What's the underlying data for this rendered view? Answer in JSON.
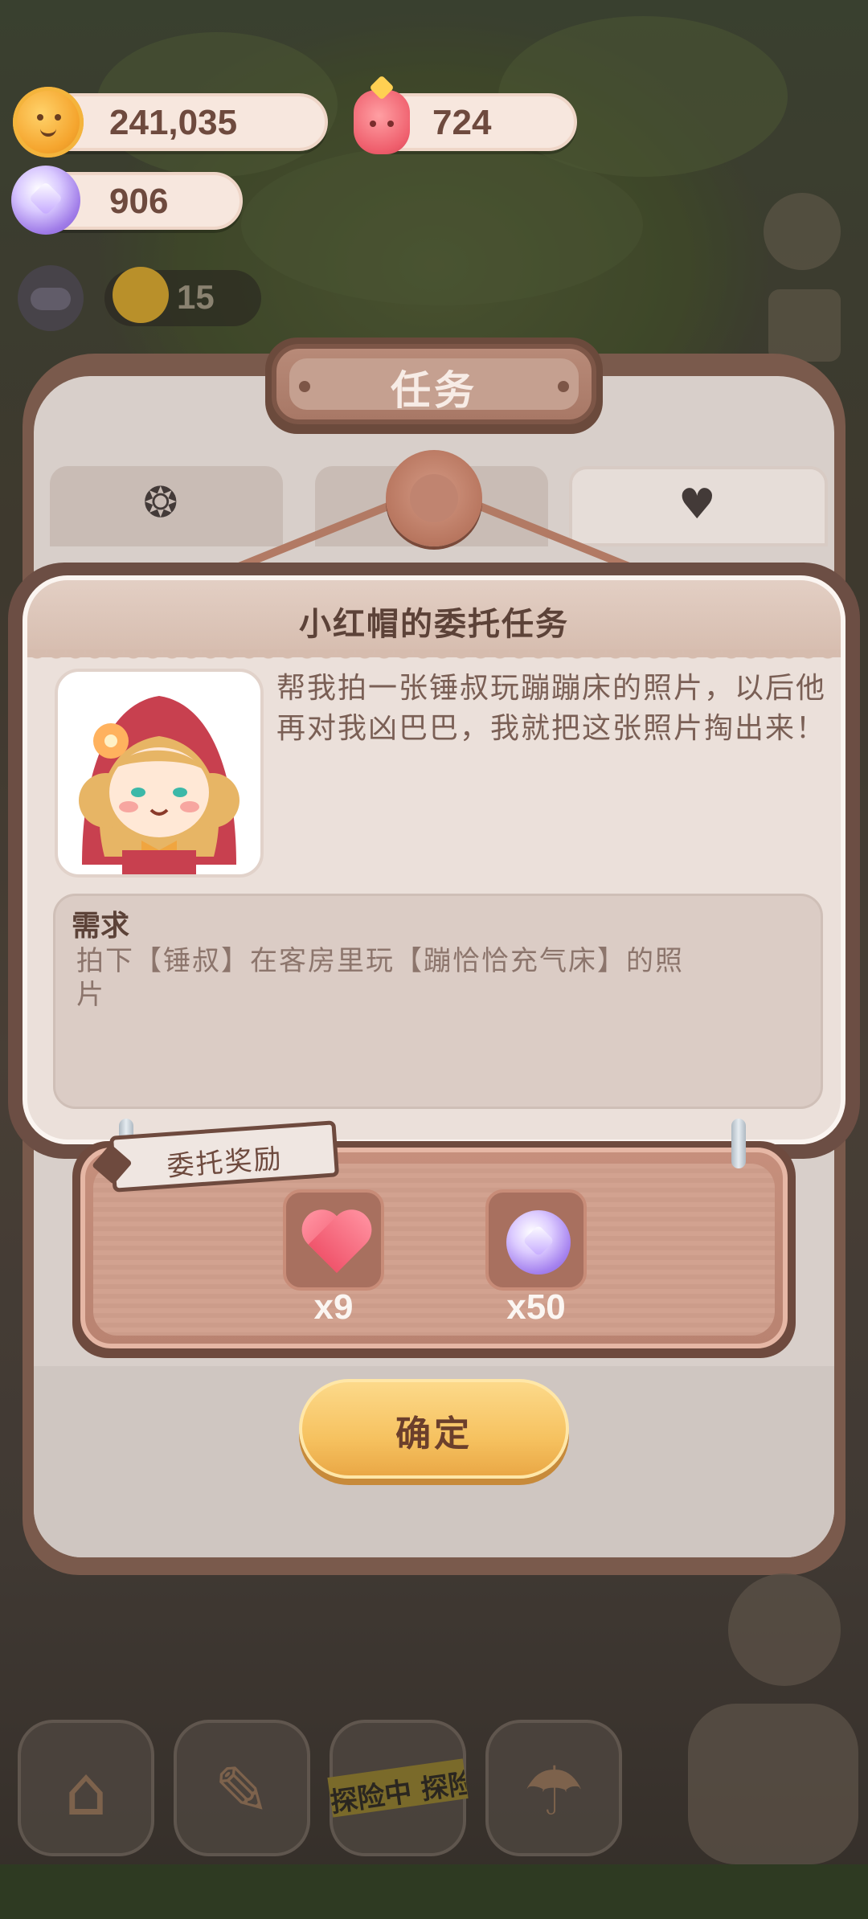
{
  "currencies": {
    "coins": {
      "value": "241,035",
      "icon": "cookie-coin-icon"
    },
    "red": {
      "value": "724",
      "icon": "red-jelly-icon"
    },
    "gems": {
      "value": "906",
      "icon": "purple-candy-icon"
    }
  },
  "energy": {
    "value": "15",
    "icon": "energy-icon"
  },
  "panel": {
    "title": "任务",
    "tabs": [
      {
        "icon": "badge-paw-icon",
        "glyph": "❂"
      },
      {
        "icon": "tab-middle-icon",
        "glyph": ""
      },
      {
        "icon": "heart-bottle-icon",
        "glyph": "♥"
      }
    ]
  },
  "commission": {
    "title": "小红帽的委托任务",
    "portrait": "little-red-riding-hood-portrait",
    "dialog": "帮我拍一张锤叔玩蹦蹦床的照片，以后他再对我凶巴巴，我就把这张照片掏出来！",
    "requirement_title": "需求",
    "requirement_text": "拍下【锤叔】在客房里玩【蹦恰恰充气床】的照片"
  },
  "reward": {
    "label": "委托奖励",
    "items": [
      {
        "icon": "heart-icon",
        "count": "x9"
      },
      {
        "icon": "purple-candy-icon",
        "count": "x50"
      }
    ]
  },
  "confirm_label": "确定",
  "bottom_nav": {
    "explore_label": "探险中 探险"
  },
  "colors": {
    "panel_frame": "#7a5a4c",
    "card_bg": "#ebe0da",
    "reward_bg": "#c68f7c",
    "confirm_button": "#f6c260",
    "title_text": "#5c4238"
  }
}
